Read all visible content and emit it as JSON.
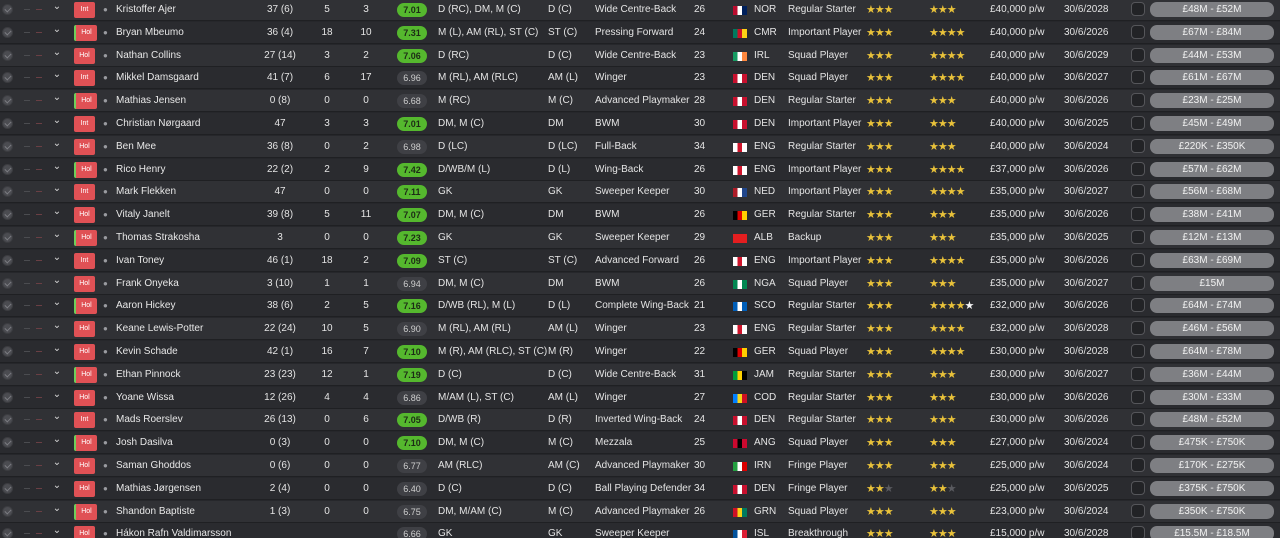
{
  "colors": {
    "accent_red": "#e05155",
    "rating_green": "#55b82e",
    "star_gold": "#e9c23a",
    "value_pill": "#7e7f83"
  },
  "icons": {
    "row_check": "check-circle-icon",
    "expand": "chevron-down-icon",
    "player": "player-silhouette-icon",
    "rating_star": "star-icon"
  },
  "players": [
    {
      "badge": "Int",
      "name": "Kristoffer Ajer",
      "apps": "37 (6)",
      "goals": "5",
      "assists": "3",
      "rating": "7.01",
      "position": "D (RC), DM, M (C)",
      "short_pos": "D (C)",
      "role": "Wide Centre-Back",
      "age": "26",
      "nat": "NOR",
      "flag": [
        "#ba0c2f",
        "#fff",
        "#00205b"
      ],
      "status": "Regular Starter",
      "ca": 3,
      "pa": 3,
      "wage": "£40,000 p/w",
      "contract": "30/6/2028",
      "value": "£48M - £52M"
    },
    {
      "badge": "Hol",
      "name": "Bryan Mbeumo",
      "apps": "36 (4)",
      "goals": "18",
      "assists": "10",
      "rating": "7.31",
      "position": "M (L), AM (RL), ST (C)",
      "short_pos": "ST (C)",
      "role": "Pressing Forward",
      "age": "24",
      "nat": "CMR",
      "flag": [
        "#007a5e",
        "#ce1126",
        "#fcd116"
      ],
      "status": "Important Player",
      "ca": 3.5,
      "pa": 3.5,
      "wage": "£40,000 p/w",
      "contract": "30/6/2026",
      "value": "£67M - £84M"
    },
    {
      "badge": "Hol",
      "name": "Nathan Collins",
      "apps": "27 (14)",
      "goals": "3",
      "assists": "2",
      "rating": "7.06",
      "position": "D (RC)",
      "short_pos": "D (C)",
      "role": "Wide Centre-Back",
      "age": "23",
      "nat": "IRL",
      "flag": [
        "#169b62",
        "#fff",
        "#ff883e"
      ],
      "status": "Squad Player",
      "ca": 3,
      "pa": 3.5,
      "wage": "£40,000 p/w",
      "contract": "30/6/2029",
      "value": "£44M - £53M"
    },
    {
      "badge": "Int",
      "name": "Mikkel Damsgaard",
      "apps": "41 (7)",
      "goals": "6",
      "assists": "17",
      "rating": "6.96",
      "position": "M (RL), AM (RLC)",
      "short_pos": "AM (L)",
      "role": "Winger",
      "age": "23",
      "nat": "DEN",
      "flag": [
        "#c8102e",
        "#fff",
        "#c8102e"
      ],
      "status": "Squad Player",
      "ca": 3.5,
      "pa": 3.5,
      "wage": "£40,000 p/w",
      "contract": "30/6/2027",
      "value": "£61M - £67M"
    },
    {
      "badge": "Hol",
      "name": "Mathias Jensen",
      "apps": "0 (8)",
      "goals": "0",
      "assists": "0",
      "rating": "6.68",
      "position": "M (RC)",
      "short_pos": "M (C)",
      "role": "Advanced Playmaker",
      "age": "28",
      "nat": "DEN",
      "flag": [
        "#c8102e",
        "#fff",
        "#c8102e"
      ],
      "status": "Regular Starter",
      "ca": 3,
      "pa": 3,
      "wage": "£40,000 p/w",
      "contract": "30/6/2026",
      "value": "£23M - £25M"
    },
    {
      "badge": "Int",
      "name": "Christian Nørgaard",
      "apps": "47",
      "goals": "3",
      "assists": "3",
      "rating": "7.01",
      "position": "DM, M (C)",
      "short_pos": "DM",
      "role": "BWM",
      "age": "30",
      "nat": "DEN",
      "flag": [
        "#c8102e",
        "#fff",
        "#c8102e"
      ],
      "status": "Important Player",
      "ca": 3,
      "pa": 3,
      "wage": "£40,000 p/w",
      "contract": "30/6/2025",
      "value": "£45M - £49M"
    },
    {
      "badge": "Hol",
      "name": "Ben Mee",
      "apps": "36 (8)",
      "goals": "0",
      "assists": "2",
      "rating": "6.98",
      "position": "D (LC)",
      "short_pos": "D (LC)",
      "role": "Full-Back",
      "age": "34",
      "nat": "ENG",
      "flag": [
        "#fff",
        "#cf142b",
        "#fff"
      ],
      "status": "Regular Starter",
      "ca": 2.5,
      "pa": 2.5,
      "wage": "£40,000 p/w",
      "contract": "30/6/2024",
      "value": "£220K - £350K"
    },
    {
      "badge": "Hol",
      "name": "Rico Henry",
      "apps": "22 (2)",
      "goals": "2",
      "assists": "9",
      "rating": "7.42",
      "position": "D/WB/M (L)",
      "short_pos": "D (L)",
      "role": "Wing-Back",
      "age": "26",
      "nat": "ENG",
      "flag": [
        "#fff",
        "#cf142b",
        "#fff"
      ],
      "status": "Important Player",
      "ca": 3.5,
      "pa": 3.5,
      "wage": "£37,000 p/w",
      "contract": "30/6/2026",
      "value": "£57M - £62M"
    },
    {
      "badge": "Int",
      "name": "Mark Flekken",
      "apps": "47",
      "goals": "0",
      "assists": "0",
      "rating": "7.11",
      "position": "GK",
      "short_pos": "GK",
      "role": "Sweeper Keeper",
      "age": "30",
      "nat": "NED",
      "flag": [
        "#ae1c28",
        "#fff",
        "#21468b"
      ],
      "status": "Important Player",
      "ca": 4,
      "pa": 4,
      "wage": "£35,000 p/w",
      "contract": "30/6/2027",
      "value": "£56M - £68M"
    },
    {
      "badge": "Hol",
      "name": "Vitaly Janelt",
      "apps": "39 (8)",
      "goals": "5",
      "assists": "11",
      "rating": "7.07",
      "position": "DM, M (C)",
      "short_pos": "DM",
      "role": "BWM",
      "age": "26",
      "nat": "GER",
      "flag": [
        "#000",
        "#dd0000",
        "#ffce00"
      ],
      "status": "Regular Starter",
      "ca": 3,
      "pa": 3,
      "wage": "£35,000 p/w",
      "contract": "30/6/2026",
      "value": "£38M - £41M"
    },
    {
      "badge": "Hol",
      "name": "Thomas Strakosha",
      "apps": "3",
      "goals": "0",
      "assists": "0",
      "rating": "7.23",
      "position": "GK",
      "short_pos": "GK",
      "role": "Sweeper Keeper",
      "age": "29",
      "nat": "ALB",
      "flag": [
        "#e41e20",
        "#e41e20",
        "#e41e20"
      ],
      "status": "Backup",
      "ca": 3,
      "pa": 3,
      "wage": "£35,000 p/w",
      "contract": "30/6/2025",
      "value": "£12M - £13M"
    },
    {
      "badge": "Int",
      "name": "Ivan Toney",
      "apps": "46 (1)",
      "goals": "18",
      "assists": "2",
      "rating": "7.09",
      "position": "ST (C)",
      "short_pos": "ST (C)",
      "role": "Advanced Forward",
      "age": "26",
      "nat": "ENG",
      "flag": [
        "#fff",
        "#cf142b",
        "#fff"
      ],
      "status": "Important Player",
      "ca": 4,
      "pa": 4,
      "wage": "£35,000 p/w",
      "contract": "30/6/2026",
      "value": "£63M - £69M"
    },
    {
      "badge": "Hol",
      "name": "Frank Onyeka",
      "apps": "3 (10)",
      "goals": "1",
      "assists": "1",
      "rating": "6.94",
      "position": "DM, M (C)",
      "short_pos": "DM",
      "role": "BWM",
      "age": "26",
      "nat": "NGA",
      "flag": [
        "#008751",
        "#fff",
        "#008751"
      ],
      "status": "Squad Player",
      "ca": 2.5,
      "pa": 2.5,
      "wage": "£35,000 p/w",
      "contract": "30/6/2027",
      "value": "£15M"
    },
    {
      "badge": "Hol",
      "name": "Aaron Hickey",
      "apps": "38 (6)",
      "goals": "2",
      "assists": "5",
      "rating": "7.16",
      "position": "D/WB (RL), M (L)",
      "short_pos": "D (L)",
      "role": "Complete Wing-Back",
      "age": "21",
      "nat": "SCO",
      "flag": [
        "#005eb8",
        "#fff",
        "#005eb8"
      ],
      "status": "Regular Starter",
      "ca": 3.5,
      "pa": 5,
      "wage": "£32,000 p/w",
      "contract": "30/6/2026",
      "value": "£64M - £74M"
    },
    {
      "badge": "Hol",
      "name": "Keane Lewis-Potter",
      "apps": "22 (24)",
      "goals": "10",
      "assists": "5",
      "rating": "6.90",
      "position": "M (RL), AM (RL)",
      "short_pos": "AM (L)",
      "role": "Winger",
      "age": "23",
      "nat": "ENG",
      "flag": [
        "#fff",
        "#cf142b",
        "#fff"
      ],
      "status": "Regular Starter",
      "ca": 3,
      "pa": 3.5,
      "wage": "£32,000 p/w",
      "contract": "30/6/2028",
      "value": "£46M - £56M"
    },
    {
      "badge": "Hol",
      "name": "Kevin Schade",
      "apps": "42 (1)",
      "goals": "16",
      "assists": "7",
      "rating": "7.10",
      "position": "M (R), AM (RLC), ST (C)",
      "short_pos": "M (R)",
      "role": "Winger",
      "age": "22",
      "nat": "GER",
      "flag": [
        "#000",
        "#dd0000",
        "#ffce00"
      ],
      "status": "Squad Player",
      "ca": 3.5,
      "pa": 3.5,
      "wage": "£30,000 p/w",
      "contract": "30/6/2028",
      "value": "£64M - £78M"
    },
    {
      "badge": "Hol",
      "name": "Ethan Pinnock",
      "apps": "23 (23)",
      "goals": "12",
      "assists": "1",
      "rating": "7.19",
      "position": "D (C)",
      "short_pos": "D (C)",
      "role": "Wide Centre-Back",
      "age": "31",
      "nat": "JAM",
      "flag": [
        "#009b3a",
        "#fed100",
        "#000"
      ],
      "status": "Regular Starter",
      "ca": 3,
      "pa": 3,
      "wage": "£30,000 p/w",
      "contract": "30/6/2027",
      "value": "£36M - £44M"
    },
    {
      "badge": "Hol",
      "name": "Yoane Wissa",
      "apps": "12 (26)",
      "goals": "4",
      "assists": "4",
      "rating": "6.86",
      "position": "M/AM (L), ST (C)",
      "short_pos": "AM (L)",
      "role": "Winger",
      "age": "27",
      "nat": "COD",
      "flag": [
        "#007fff",
        "#f7d618",
        "#ce1021"
      ],
      "status": "Regular Starter",
      "ca": 3,
      "pa": 3,
      "wage": "£30,000 p/w",
      "contract": "30/6/2026",
      "value": "£30M - £33M"
    },
    {
      "badge": "Int",
      "name": "Mads Roerslev",
      "apps": "26 (13)",
      "goals": "0",
      "assists": "6",
      "rating": "7.05",
      "position": "D/WB (R)",
      "short_pos": "D (R)",
      "role": "Inverted Wing-Back",
      "age": "24",
      "nat": "DEN",
      "flag": [
        "#c8102e",
        "#fff",
        "#c8102e"
      ],
      "status": "Regular Starter",
      "ca": 3,
      "pa": 3,
      "wage": "£30,000 p/w",
      "contract": "30/6/2026",
      "value": "£48M - £52M"
    },
    {
      "badge": "Hol",
      "name": "Josh Dasilva",
      "apps": "0 (3)",
      "goals": "0",
      "assists": "0",
      "rating": "7.10",
      "position": "DM, M (C)",
      "short_pos": "M (C)",
      "role": "Mezzala",
      "age": "25",
      "nat": "ANG",
      "flag": [
        "#cc092f",
        "#000",
        "#cc092f"
      ],
      "status": "Squad Player",
      "ca": 2.5,
      "pa": 2.5,
      "wage": "£27,000 p/w",
      "contract": "30/6/2024",
      "value": "£475K - £750K"
    },
    {
      "badge": "Hol",
      "name": "Saman Ghoddos",
      "apps": "0 (6)",
      "goals": "0",
      "assists": "0",
      "rating": "6.77",
      "position": "AM (RLC)",
      "short_pos": "AM (C)",
      "role": "Advanced Playmaker",
      "age": "30",
      "nat": "IRN",
      "flag": [
        "#239f40",
        "#fff",
        "#da0000"
      ],
      "status": "Fringe Player",
      "ca": 2.5,
      "pa": 2.5,
      "wage": "£25,000 p/w",
      "contract": "30/6/2024",
      "value": "£170K - £275K"
    },
    {
      "badge": "Hol",
      "name": "Mathias Jørgensen",
      "apps": "2 (4)",
      "goals": "0",
      "assists": "0",
      "rating": "6.40",
      "position": "D (C)",
      "short_pos": "D (C)",
      "role": "Ball Playing Defender",
      "age": "34",
      "nat": "DEN",
      "flag": [
        "#c8102e",
        "#fff",
        "#c8102e"
      ],
      "status": "Fringe Player",
      "ca": 2,
      "pa": 2,
      "wage": "£25,000 p/w",
      "contract": "30/6/2025",
      "value": "£375K - £750K"
    },
    {
      "badge": "Hol",
      "name": "Shandon Baptiste",
      "apps": "1 (3)",
      "goals": "0",
      "assists": "0",
      "rating": "6.75",
      "position": "DM, M/AM (C)",
      "short_pos": "M (C)",
      "role": "Advanced Playmaker",
      "age": "26",
      "nat": "GRN",
      "flag": [
        "#ce1126",
        "#fcd116",
        "#007a5e"
      ],
      "status": "Squad Player",
      "ca": 2.5,
      "pa": 2.5,
      "wage": "£23,000 p/w",
      "contract": "30/6/2024",
      "value": "£350K - £750K"
    },
    {
      "badge": "Hol",
      "name": "Hákon Rafn Valdimarsson",
      "apps": "",
      "goals": "",
      "assists": "",
      "rating": "6.66",
      "position": "GK",
      "short_pos": "GK",
      "role": "Sweeper Keeper",
      "age": "",
      "nat": "ISL",
      "flag": [
        "#02529c",
        "#fff",
        "#dc1e35"
      ],
      "status": "Breakthrough",
      "ca": 2.5,
      "pa": 3,
      "wage": "£15,000 p/w",
      "contract": "30/6/2028",
      "value": "£15.5M - £18.5M"
    }
  ]
}
